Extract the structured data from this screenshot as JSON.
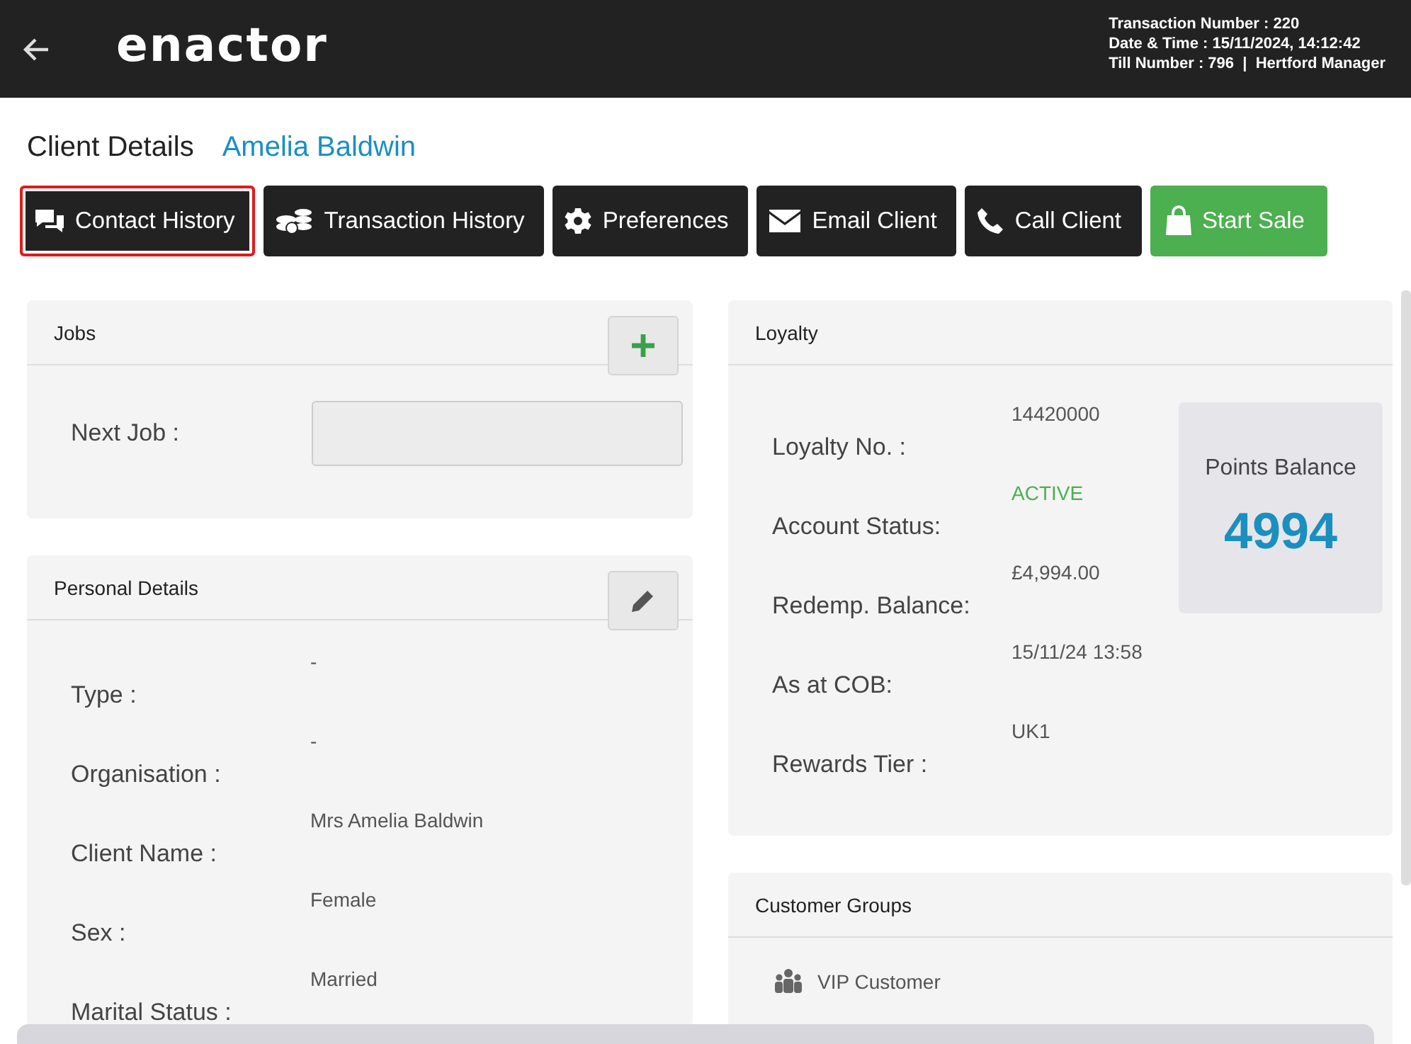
{
  "header": {
    "logo": "enactor",
    "info": [
      "Transaction Number : 220",
      "Date & Time : 15/11/2024, 14:12:42",
      "Till Number : 796  |  Hertford Manager"
    ]
  },
  "page": {
    "title": "Client Details",
    "client_name": "Amelia Baldwin"
  },
  "actions": [
    {
      "label": "Contact History",
      "kind": "default",
      "selected": true
    },
    {
      "label": "Transaction History",
      "kind": "default",
      "selected": false
    },
    {
      "label": "Preferences",
      "kind": "default",
      "selected": false
    },
    {
      "label": "Email Client",
      "kind": "default",
      "selected": false
    },
    {
      "label": "Call Client",
      "kind": "default",
      "selected": false
    },
    {
      "label": "Start Sale",
      "kind": "primary",
      "selected": false
    }
  ],
  "jobs": {
    "title": "Jobs",
    "fields": [
      {
        "label": "Next Job :"
      }
    ]
  },
  "personal_details": {
    "title": "Personal Details",
    "rows": [
      {
        "label": "Type :",
        "value": "-"
      },
      {
        "label": "Organisation :",
        "value": "-"
      },
      {
        "label": "Client Name :",
        "value": "Mrs Amelia Baldwin"
      },
      {
        "label": "Sex :",
        "value": "Female"
      },
      {
        "label": "Marital Status :",
        "value": "Married"
      }
    ]
  },
  "loyalty": {
    "title": "Loyalty",
    "rows": [
      {
        "label": "Loyalty No. :",
        "value": "14420000",
        "kind": "plain"
      },
      {
        "label": "Account Status:",
        "value": "ACTIVE",
        "kind": "status"
      },
      {
        "label": "Redemp. Balance:",
        "value": "£4,994.00",
        "kind": "plain"
      },
      {
        "label": "As at COB:",
        "value": "15/11/24 13:58",
        "kind": "plain"
      },
      {
        "label": "Rewards Tier :",
        "value": "UK1",
        "kind": "plain"
      }
    ],
    "points": {
      "label": "Points Balance",
      "value": "4994"
    }
  },
  "customer_groups": {
    "title": "Customer Groups",
    "items": [
      "VIP Customer"
    ]
  }
}
